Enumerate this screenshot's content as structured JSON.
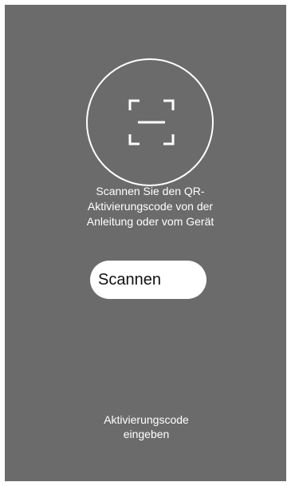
{
  "scan": {
    "icon": "qr-scan-frame-icon",
    "instructions": [
      "Scannen Sie den QR-",
      "Aktivierungscode von der",
      "Anleitung oder vom Gerät"
    ],
    "button_label": "Scannen"
  },
  "manual_entry": {
    "lines": [
      "Aktivierungscode",
      "eingeben"
    ]
  },
  "colors": {
    "background": "#6b6b6b",
    "foreground": "#ffffff",
    "button_text": "#111111"
  }
}
